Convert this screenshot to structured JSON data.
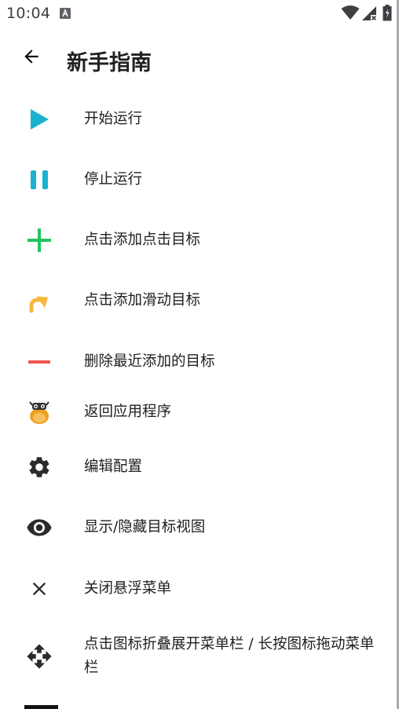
{
  "status_bar": {
    "time": "10:04",
    "notification_icon": "font-a-icon",
    "wifi_icon": "wifi-icon",
    "signal_icon": "signal-no-data-icon",
    "battery_icon": "battery-icon"
  },
  "header": {
    "back_icon": "arrow-back-icon",
    "title": "新手指南"
  },
  "guide_items": [
    {
      "label": "开始运行",
      "icon": "play-icon",
      "color": "#1ab2cf"
    },
    {
      "label": "停止运行",
      "icon": "pause-icon",
      "color": "#1ab2cf"
    },
    {
      "label": "点击添加点击目标",
      "icon": "plus-icon",
      "color": "#22c55e"
    },
    {
      "label": "点击添加滑动目标",
      "icon": "swipe-arrow-icon",
      "color": "#f6b73c"
    },
    {
      "label": "删除最近添加的目标",
      "icon": "minus-icon",
      "color": "#ef5350"
    },
    {
      "label": "返回应用程序",
      "icon": "app-mascot-icon",
      "color": "#f0a020"
    },
    {
      "label": "编辑配置",
      "icon": "gear-icon",
      "color": "#2b2b2b"
    },
    {
      "label": "显示/隐藏目标视图",
      "icon": "eye-icon",
      "color": "#2b2b2b"
    },
    {
      "label": "关闭悬浮菜单",
      "icon": "close-icon",
      "color": "#2b2b2b"
    },
    {
      "label": "点击图标折叠展开菜单栏 / 长按图标拖动菜单栏",
      "icon": "move-icon",
      "color": "#2b2b2b"
    }
  ]
}
